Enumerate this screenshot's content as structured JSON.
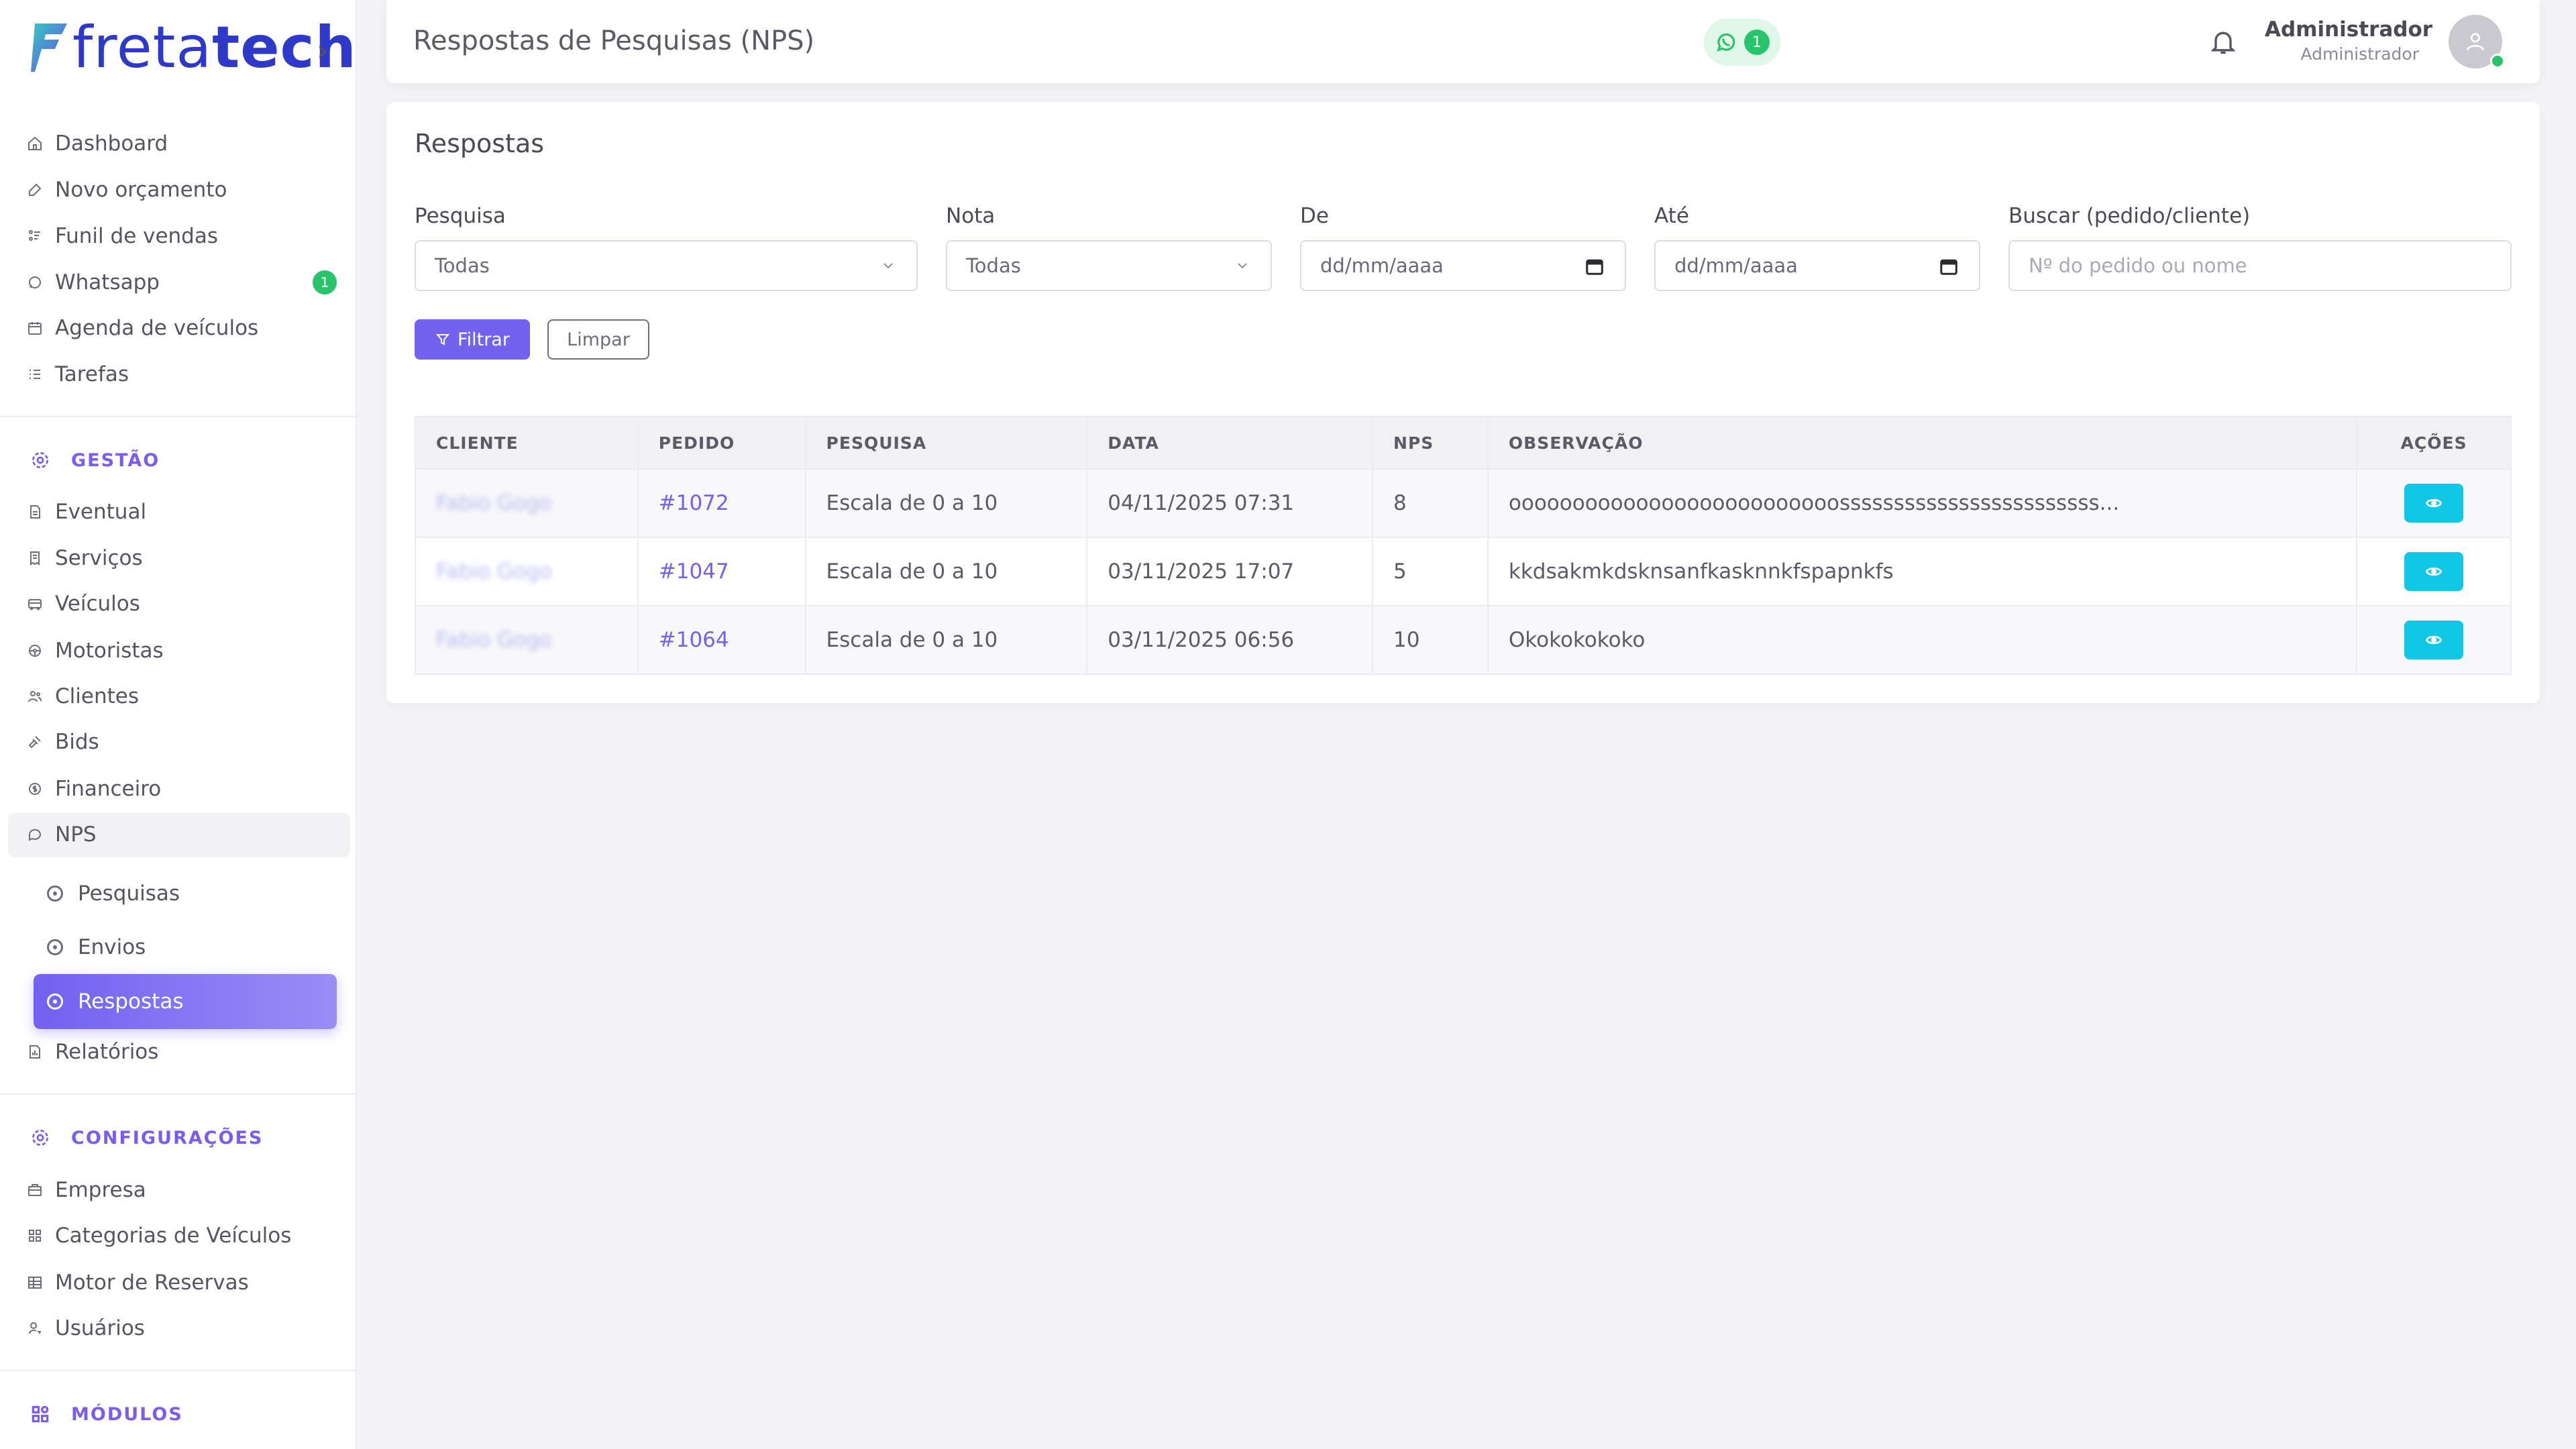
{
  "brand": {
    "logo_light": "freta",
    "logo_bold": "tech"
  },
  "colors": {
    "accent": "#7361f0",
    "success": "#27c46a",
    "info": "#11c7e6",
    "brand": "#2f39c9"
  },
  "sidebar": {
    "main_items": [
      {
        "label": "Dashboard",
        "icon": "home-icon"
      },
      {
        "label": "Novo orçamento",
        "icon": "edit-icon"
      },
      {
        "label": "Funil de vendas",
        "icon": "funnel-icon"
      },
      {
        "label": "Whatsapp",
        "icon": "whatsapp-icon",
        "badge": "1"
      },
      {
        "label": "Agenda de veículos",
        "icon": "calendar-icon"
      },
      {
        "label": "Tarefas",
        "icon": "list-icon"
      }
    ],
    "section_gestao": "GESTÃO",
    "gestao_items": [
      {
        "label": "Eventual",
        "icon": "file-icon"
      },
      {
        "label": "Serviços",
        "icon": "receipt-icon"
      },
      {
        "label": "Veículos",
        "icon": "bus-icon"
      },
      {
        "label": "Motoristas",
        "icon": "steering-wheel-icon"
      },
      {
        "label": "Clientes",
        "icon": "users-icon"
      },
      {
        "label": "Bids",
        "icon": "gavel-icon"
      },
      {
        "label": "Financeiro",
        "icon": "coin-icon"
      },
      {
        "label": "NPS",
        "icon": "chat-icon"
      }
    ],
    "nps_sub": [
      {
        "label": "Pesquisas"
      },
      {
        "label": "Envios"
      },
      {
        "label": "Respostas"
      }
    ],
    "relatorios": "Relatórios",
    "section_config": "CONFIGURAÇÕES",
    "config_items": [
      {
        "label": "Empresa",
        "icon": "building-icon"
      },
      {
        "label": "Categorias de Veículos",
        "icon": "grid-icon"
      },
      {
        "label": "Motor de Reservas",
        "icon": "table-icon"
      },
      {
        "label": "Usuários",
        "icon": "user-key-icon"
      }
    ],
    "section_modulos": "MÓDULOS"
  },
  "header": {
    "title": "Respostas de Pesquisas (NPS)",
    "whatsapp_count": "1",
    "user_name": "Administrador",
    "user_role": "Administrador"
  },
  "card": {
    "title": "Respostas",
    "filters": {
      "pesquisa_label": "Pesquisa",
      "pesquisa_value": "Todas",
      "nota_label": "Nota",
      "nota_value": "Todas",
      "de_label": "De",
      "de_placeholder": "dd/mm/aaaa",
      "ate_label": "Até",
      "ate_placeholder": "dd/mm/aaaa",
      "buscar_label": "Buscar (pedido/cliente)",
      "buscar_placeholder": "Nº do pedido ou nome"
    },
    "btn_filter": "Filtrar",
    "btn_clear": "Limpar"
  },
  "table": {
    "headers": [
      "CLIENTE",
      "PEDIDO",
      "PESQUISA",
      "DATA",
      "NPS",
      "OBSERVAÇÃO",
      "AÇÕES"
    ],
    "rows": [
      {
        "cliente": "Fabio Gogo",
        "pedido": "#1072",
        "pesquisa": "Escala de 0 a 10",
        "data": "04/11/2025 07:31",
        "nps": "8",
        "obs": "oooooooooooooooooooooooooossssssssssssssssssssssss..."
      },
      {
        "cliente": "Fabio Gogo",
        "pedido": "#1047",
        "pesquisa": "Escala de 0 a 10",
        "data": "03/11/2025 17:07",
        "nps": "5",
        "obs": "kkdsakmkdsknsanfkasknnkfspapnkfs"
      },
      {
        "cliente": "Fabio Gogo",
        "pedido": "#1064",
        "pesquisa": "Escala de 0 a 10",
        "data": "03/11/2025 06:56",
        "nps": "10",
        "obs": "Okokokokoko"
      }
    ]
  }
}
